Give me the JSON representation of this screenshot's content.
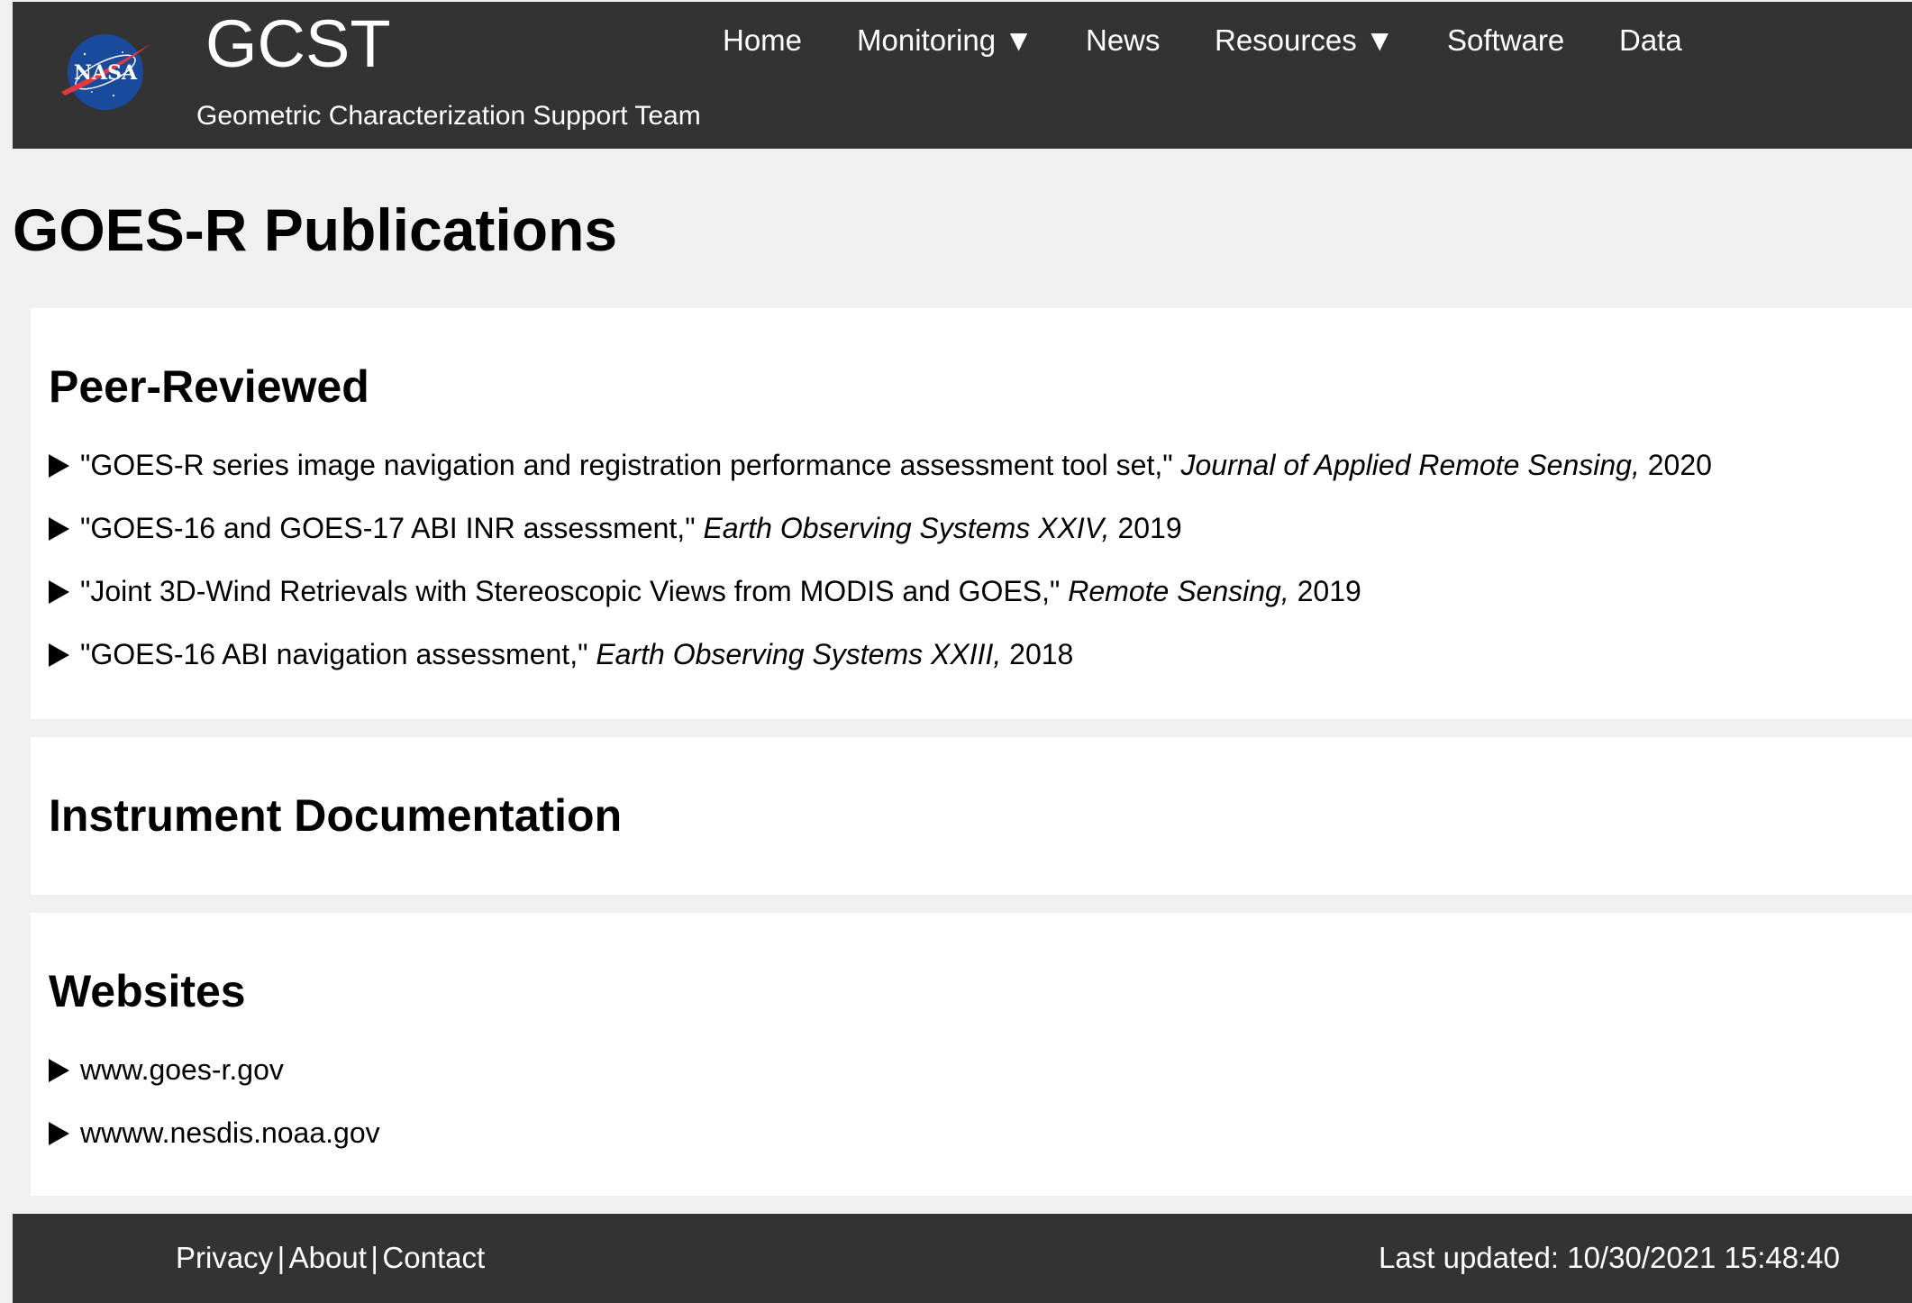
{
  "header": {
    "logo_text": "NASA",
    "title": "GCST",
    "subtitle": "Geometric Characterization Support Team",
    "nav": [
      {
        "label": "Home"
      },
      {
        "label": "Monitoring ▼"
      },
      {
        "label": "News"
      },
      {
        "label": "Resources ▼"
      },
      {
        "label": "Software"
      },
      {
        "label": "Data"
      }
    ]
  },
  "page": {
    "title": "GOES-R Publications"
  },
  "peer_reviewed": {
    "heading": "Peer-Reviewed",
    "items": [
      {
        "title": "\"GOES-R series image navigation and registration performance assessment tool set,\"",
        "journal": "Journal of Applied Remote Sensing,",
        "year": "2020"
      },
      {
        "title": "\"GOES-16 and GOES-17 ABI INR assessment,\"",
        "journal": "Earth Observing Systems XXIV,",
        "year": "2019"
      },
      {
        "title": "\"Joint 3D-Wind Retrievals with Stereoscopic Views from MODIS and GOES,\"",
        "journal": "Remote Sensing,",
        "year": "2019"
      },
      {
        "title": "\"GOES-16 ABI navigation assessment,\"",
        "journal": "Earth Observing Systems XXIII,",
        "year": "2018"
      }
    ]
  },
  "instrument_docs": {
    "heading": "Instrument Documentation"
  },
  "websites": {
    "heading": "Websites",
    "items": [
      {
        "label": "www.goes-r.gov"
      },
      {
        "label": "wwww.nesdis.noaa.gov"
      }
    ]
  },
  "footer": {
    "links": [
      {
        "label": "Privacy"
      },
      {
        "label": "About"
      },
      {
        "label": "Contact"
      }
    ],
    "separator": "|",
    "last_updated": "Last updated: 10/30/2021 15:48:40"
  },
  "colors": {
    "bar": "#333333",
    "page_bg": "#f0f0f0",
    "card_bg": "#ffffff",
    "nasa_blue": "#1a4a9c",
    "nasa_red": "#e03a3e"
  }
}
